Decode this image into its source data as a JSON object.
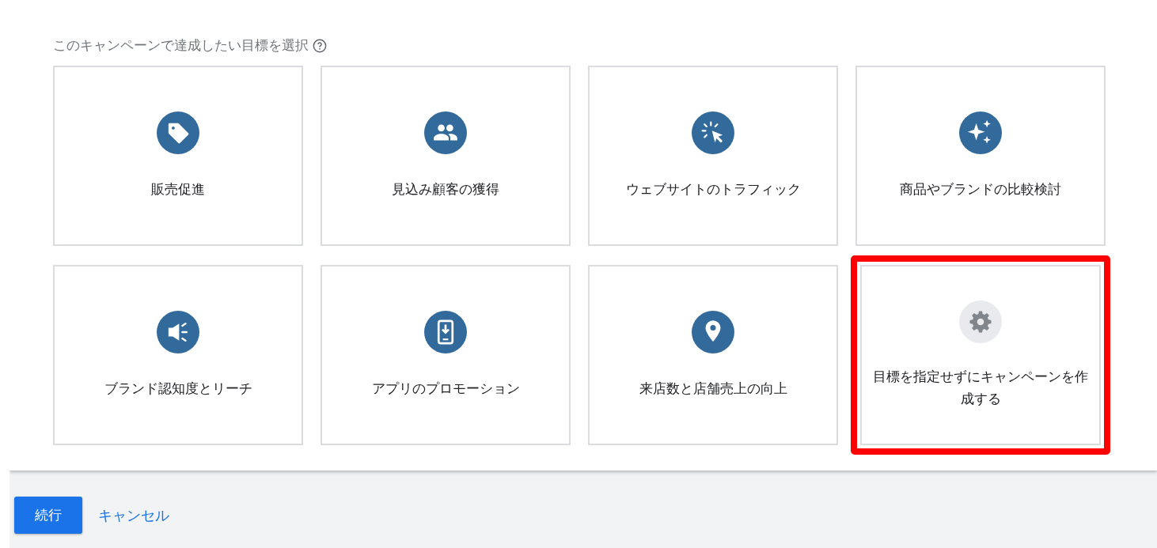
{
  "prompt": "このキャンペーンで達成したい目標を選択",
  "options": [
    {
      "kind": "sales",
      "label": "販売促進",
      "highlighted": false
    },
    {
      "kind": "leads",
      "label": "見込み顧客の獲得",
      "highlighted": false
    },
    {
      "kind": "traffic",
      "label": "ウェブサイトのトラフィック",
      "highlighted": false
    },
    {
      "kind": "consideration",
      "label": "商品やブランドの比較検討",
      "highlighted": false
    },
    {
      "kind": "awareness",
      "label": "ブランド認知度とリーチ",
      "highlighted": false
    },
    {
      "kind": "app",
      "label": "アプリのプロモーション",
      "highlighted": false
    },
    {
      "kind": "store",
      "label": "来店数と店舗売上の向上",
      "highlighted": false
    },
    {
      "kind": "none",
      "label": "目標を指定せずにキャンペーンを作成する",
      "highlighted": true
    }
  ],
  "buttons": {
    "continue": "続行",
    "cancel": "キャンセル"
  }
}
